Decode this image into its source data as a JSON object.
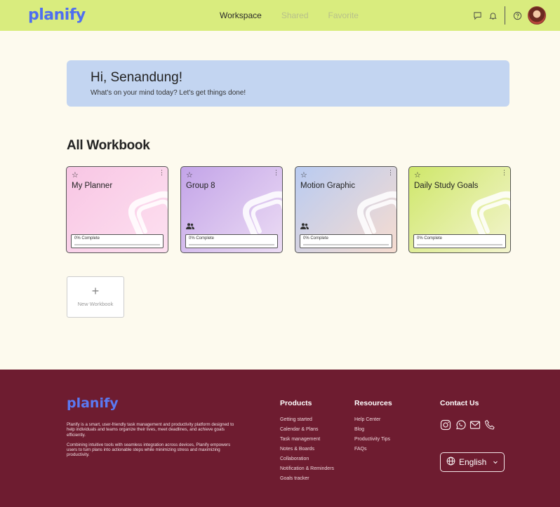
{
  "brand": {
    "name": "planify"
  },
  "nav": {
    "workspace": "Workspace",
    "shared": "Shared",
    "favorite": "Favorite"
  },
  "welcome": {
    "greeting": "Hi, Senandung!",
    "subtitle": "What's on your mind today? Let's get things done!"
  },
  "section": {
    "title": "All Workbook"
  },
  "workbooks": [
    {
      "title": "My Planner",
      "progress": "0% Complete",
      "progress_value": 0,
      "shared": false,
      "gradient": [
        "#f8c6e4",
        "#fde0f0"
      ],
      "star_icon": "star-outline-icon"
    },
    {
      "title": "Group 8",
      "progress": "0% Complete",
      "progress_value": 0,
      "shared": true,
      "gradient": [
        "#c3a4e8",
        "#ecdcf4"
      ],
      "star_icon": "star-outline-icon"
    },
    {
      "title": "Motion Graphic",
      "progress": "0% Complete",
      "progress_value": 0,
      "shared": true,
      "gradient": [
        "#b9cbf1",
        "#f6dcd0"
      ],
      "star_icon": "star-outline-icon"
    },
    {
      "title": "Daily Study Goals",
      "progress": "0% Complete",
      "progress_value": 0,
      "shared": false,
      "gradient": [
        "#cfe76a",
        "#f3f4ce"
      ],
      "star_icon": "star-outline-icon"
    }
  ],
  "new_workbook": {
    "plus": "+",
    "label": "New Workbook"
  },
  "footer": {
    "brand": "planify",
    "description_1": "Planify is a smart, user-friendly task management and productivity platform designed to help individuals and teams organize their lives, meet deadlines, and achieve goals efficiently.",
    "description_2": "Combining intuitive tools with seamless integration across devices, Planify empowers users to turn plans into actionable steps while minimizing stress and maximizing productivity.",
    "products": {
      "title": "Products",
      "items": [
        "Getting started",
        "Calendar & Plans",
        "Task management",
        "Notes & Boards",
        "Collaboration",
        "Notification & Reminders",
        "Goals tracker"
      ]
    },
    "resources": {
      "title": "Resources",
      "items": [
        "Help Center",
        "Blog",
        "Productivity Tips",
        "FAQs"
      ]
    },
    "contact": {
      "title": "Contact Us",
      "icons": [
        "instagram-icon",
        "whatsapp-icon",
        "mail-icon",
        "phone-icon"
      ]
    },
    "language": "English"
  },
  "colors": {
    "topbar": "#d9ec7e",
    "brand": "#4f6ef0",
    "footer": "#6e1c30",
    "welcome": "#c3d5f1",
    "page": "#fdfaee"
  }
}
